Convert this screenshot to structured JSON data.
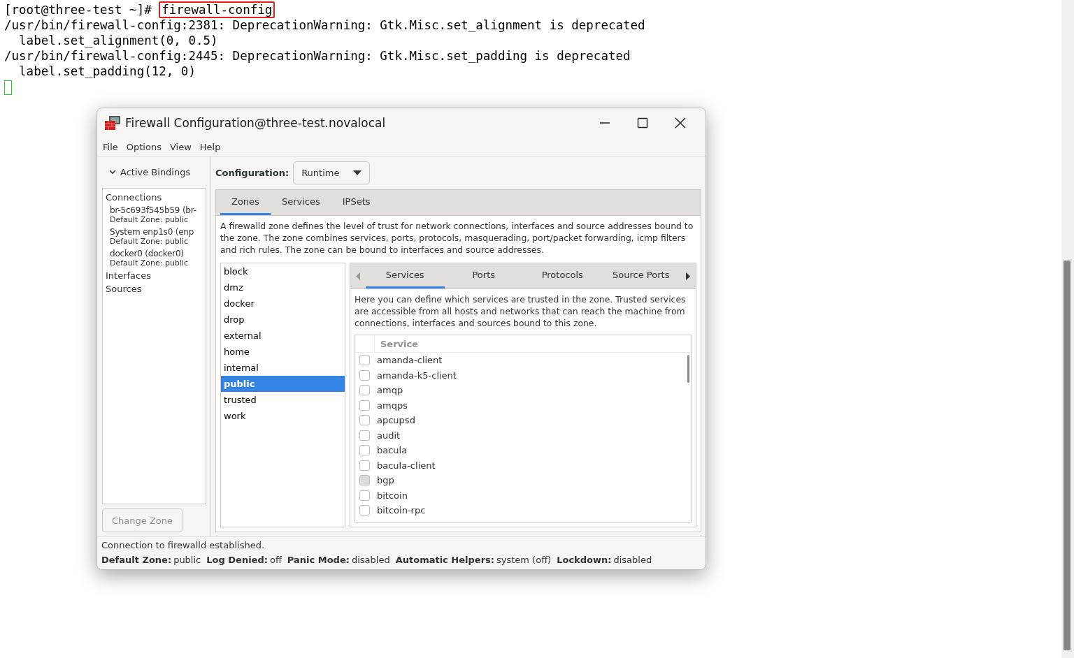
{
  "terminal": {
    "prompt": "[root@three-test ~]#",
    "command": "firewall-config",
    "output": [
      "/usr/bin/firewall-config:2381: DeprecationWarning: Gtk.Misc.set_alignment is deprecated",
      "  label.set_alignment(0, 0.5)",
      "/usr/bin/firewall-config:2445: DeprecationWarning: Gtk.Misc.set_padding is deprecated",
      "  label.set_padding(12, 0)"
    ]
  },
  "window": {
    "title": "Firewall Configuration@three-test.novalocal",
    "menu": [
      "File",
      "Options",
      "View",
      "Help"
    ]
  },
  "bindings": {
    "header": "Active Bindings",
    "expanded": true,
    "sections": [
      {
        "label": "Connections",
        "children": [
          {
            "name": "br-5c693f545b59 (br-",
            "zone": "Default Zone: public"
          },
          {
            "name": "System enp1s0 (enp",
            "zone": "Default Zone: public"
          },
          {
            "name": "docker0 (docker0)",
            "zone": "Default Zone: public"
          }
        ]
      },
      {
        "label": "Interfaces"
      },
      {
        "label": "Sources"
      }
    ],
    "button": {
      "label": "Change Zone",
      "disabled": true
    }
  },
  "configuration": {
    "label": "Configuration:",
    "value": "Runtime"
  },
  "tabs": [
    {
      "label": "Zones",
      "selected": true
    },
    {
      "label": "Services",
      "selected": false
    },
    {
      "label": "IPSets",
      "selected": false
    }
  ],
  "zone_description": "A firewalld zone defines the level of trust for network connections, interfaces and source addresses bound to the zone. The zone combines services, ports, protocols, masquerading, port/packet forwarding, icmp filters and rich rules. The zone can be bound to interfaces and source addresses.",
  "zones": [
    {
      "name": "block",
      "selected": false
    },
    {
      "name": "dmz",
      "selected": false
    },
    {
      "name": "docker",
      "selected": false
    },
    {
      "name": "drop",
      "selected": false
    },
    {
      "name": "external",
      "selected": false
    },
    {
      "name": "home",
      "selected": false
    },
    {
      "name": "internal",
      "selected": false
    },
    {
      "name": "public",
      "selected": true
    },
    {
      "name": "trusted",
      "selected": false
    },
    {
      "name": "work",
      "selected": false
    }
  ],
  "zone_tabs": [
    {
      "label": "Services",
      "selected": true
    },
    {
      "label": "Ports",
      "selected": false
    },
    {
      "label": "Protocols",
      "selected": false
    },
    {
      "label": "Source Ports",
      "selected": false
    }
  ],
  "zone_tab_description": "Here you can define which services are trusted in the zone. Trusted services are accessible from all hosts and networks that can reach the machine from connections, interfaces and sources bound to this zone.",
  "services_table": {
    "column": "Service",
    "rows": [
      {
        "name": "amanda-client",
        "checked": false,
        "hovered": false
      },
      {
        "name": "amanda-k5-client",
        "checked": false,
        "hovered": false
      },
      {
        "name": "amqp",
        "checked": false,
        "hovered": false
      },
      {
        "name": "amqps",
        "checked": false,
        "hovered": false
      },
      {
        "name": "apcupsd",
        "checked": false,
        "hovered": false
      },
      {
        "name": "audit",
        "checked": false,
        "hovered": false
      },
      {
        "name": "bacula",
        "checked": false,
        "hovered": false
      },
      {
        "name": "bacula-client",
        "checked": false,
        "hovered": false
      },
      {
        "name": "bgp",
        "checked": false,
        "hovered": true
      },
      {
        "name": "bitcoin",
        "checked": false,
        "hovered": false
      },
      {
        "name": "bitcoin-rpc",
        "checked": false,
        "hovered": false
      }
    ]
  },
  "status": {
    "message": "Connection to firewalld established.",
    "items": [
      {
        "label": "Default Zone:",
        "value": "public"
      },
      {
        "label": "Log Denied:",
        "value": "off"
      },
      {
        "label": "Panic Mode:",
        "value": "disabled"
      },
      {
        "label": "Automatic Helpers:",
        "value": "system (off)"
      },
      {
        "label": "Lockdown:",
        "value": "disabled"
      }
    ]
  }
}
